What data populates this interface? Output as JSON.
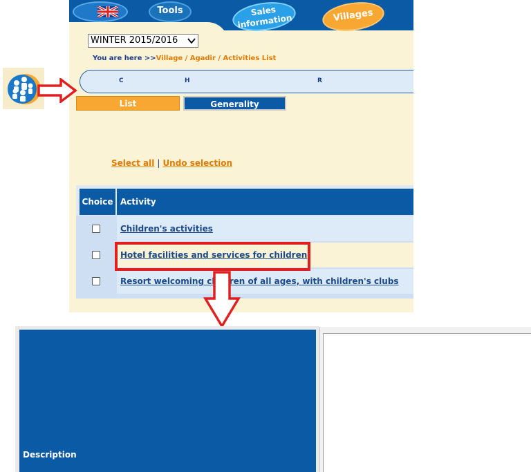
{
  "nav": {
    "language_flag": "uk-flag-icon",
    "tools_label": "Tools",
    "sales_label_line1": "Sales",
    "sales_label_line2": "information",
    "villages_label": "Villages"
  },
  "season_select": {
    "value": "WINTER 2015/2016"
  },
  "breadcrumb": {
    "prefix": "You are here >>",
    "path": "Village / Agadir / Activities List"
  },
  "letters": [
    "C",
    "H",
    "R"
  ],
  "tabs": {
    "list_label": "List",
    "generality_label": "Generality"
  },
  "selection": {
    "select_all": "Select all",
    "separator": "|",
    "undo": "Undo selection"
  },
  "activities_table": {
    "headers": {
      "choice": "Choice",
      "activity": "Activity"
    },
    "rows": [
      {
        "label": "Children's activities",
        "checked": false
      },
      {
        "label": "Hotel facilities and services for children",
        "checked": false
      },
      {
        "label": "Resort welcoming children of all ages, with children's clubs",
        "checked": false
      }
    ]
  },
  "description_panel": {
    "label": "Description",
    "value": ""
  },
  "colors": {
    "brand_blue": "#0a5aa6",
    "cream": "#fbf3d5",
    "orange": "#f7a732",
    "highlight_red": "#e02020",
    "row_light": "#ddeaf8",
    "row_cream": "#fbf3d5"
  }
}
